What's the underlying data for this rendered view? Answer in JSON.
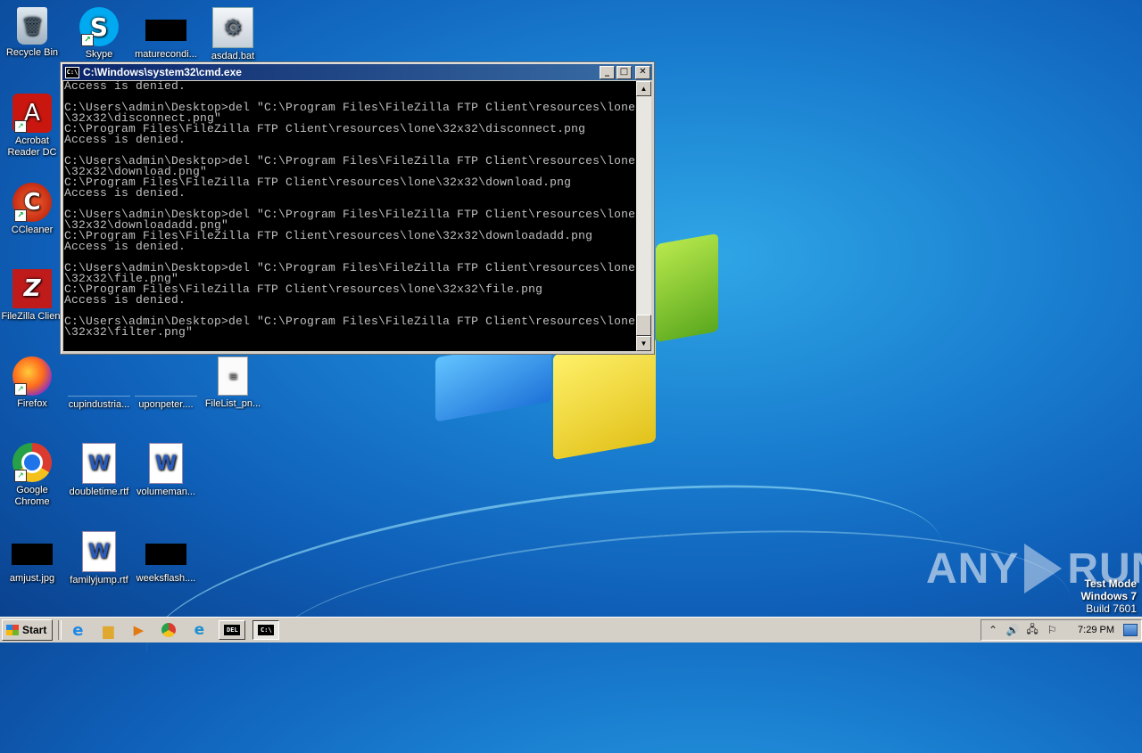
{
  "desktop": {
    "icons": [
      {
        "label": "Recycle Bin",
        "glyph": "🗑",
        "name": "recycle-bin-icon"
      },
      {
        "label": "Skype",
        "glyph": "S",
        "name": "skype-icon"
      },
      {
        "label": "maturecondi...",
        "glyph": "",
        "name": "image-file-icon"
      },
      {
        "label": "asdad.bat",
        "glyph": "⚙",
        "name": "batch-file-icon"
      },
      {
        "label": "Acrobat Reader DC",
        "glyph": "A",
        "name": "acrobat-reader-icon"
      },
      {
        "label": "CCleaner",
        "glyph": "C",
        "name": "ccleaner-icon"
      },
      {
        "label": "FileZilla Client",
        "glyph": "Z",
        "name": "filezilla-icon"
      },
      {
        "label": "Firefox",
        "glyph": "",
        "name": "firefox-icon"
      },
      {
        "label": "cupindustria...",
        "glyph": "",
        "name": "file-icon"
      },
      {
        "label": "uponpeter....",
        "glyph": "",
        "name": "file-icon"
      },
      {
        "label": "FileList_pn...",
        "glyph": "≡",
        "name": "text-file-icon"
      },
      {
        "label": "Google Chrome",
        "glyph": "",
        "name": "chrome-icon"
      },
      {
        "label": "doubletime.rtf",
        "glyph": "W",
        "name": "word-document-icon"
      },
      {
        "label": "volumeman...",
        "glyph": "W",
        "name": "word-document-icon"
      },
      {
        "label": "amjust.jpg",
        "glyph": "",
        "name": "image-file-icon"
      },
      {
        "label": "familyjump.rtf",
        "glyph": "W",
        "name": "word-document-icon"
      },
      {
        "label": "weeksflash....",
        "glyph": "",
        "name": "image-file-icon"
      }
    ]
  },
  "cmd": {
    "title": "C:\\Windows\\system32\\cmd.exe",
    "icon_text": "C:\\",
    "minimize": "_",
    "maximize": "□",
    "close": "✕",
    "scroll_up": "▲",
    "scroll_down": "▼",
    "output": "Access is denied.\n\nC:\\Users\\admin\\Desktop>del \"C:\\Program Files\\FileZilla FTP Client\\resources\\lone\n\\32x32\\disconnect.png\"\nC:\\Program Files\\FileZilla FTP Client\\resources\\lone\\32x32\\disconnect.png\nAccess is denied.\n\nC:\\Users\\admin\\Desktop>del \"C:\\Program Files\\FileZilla FTP Client\\resources\\lone\n\\32x32\\download.png\"\nC:\\Program Files\\FileZilla FTP Client\\resources\\lone\\32x32\\download.png\nAccess is denied.\n\nC:\\Users\\admin\\Desktop>del \"C:\\Program Files\\FileZilla FTP Client\\resources\\lone\n\\32x32\\downloadadd.png\"\nC:\\Program Files\\FileZilla FTP Client\\resources\\lone\\32x32\\downloadadd.png\nAccess is denied.\n\nC:\\Users\\admin\\Desktop>del \"C:\\Program Files\\FileZilla FTP Client\\resources\\lone\n\\32x32\\file.png\"\nC:\\Program Files\\FileZilla FTP Client\\resources\\lone\\32x32\\file.png\nAccess is denied.\n\nC:\\Users\\admin\\Desktop>del \"C:\\Program Files\\FileZilla FTP Client\\resources\\lone\n\\32x32\\filter.png\""
  },
  "watermark": {
    "left": "ANY",
    "right": "RUN"
  },
  "system": {
    "mode": "Test Mode",
    "os": "Windows 7",
    "build": "Build 7601"
  },
  "taskbar": {
    "start_label": "Start",
    "pinned": [
      {
        "name": "ie-icon",
        "glyph": "e"
      },
      {
        "name": "explorer-icon",
        "glyph": "▆"
      },
      {
        "name": "media-player-icon",
        "glyph": "▶"
      },
      {
        "name": "chrome-icon",
        "glyph": ""
      },
      {
        "name": "edge-icon",
        "glyph": "e"
      }
    ],
    "tasks": [
      {
        "name": "task-del-window",
        "text": "DEL"
      },
      {
        "name": "task-cmd-window",
        "text": "C:\\"
      }
    ],
    "tray_icons": [
      {
        "name": "show-hidden-icons-chevron-icon",
        "glyph": "⌃"
      },
      {
        "name": "volume-icon",
        "glyph": "🔊"
      },
      {
        "name": "network-icon",
        "glyph": "🖧"
      },
      {
        "name": "flag-icon",
        "glyph": "⚐"
      }
    ],
    "clock": "7:29 PM"
  }
}
